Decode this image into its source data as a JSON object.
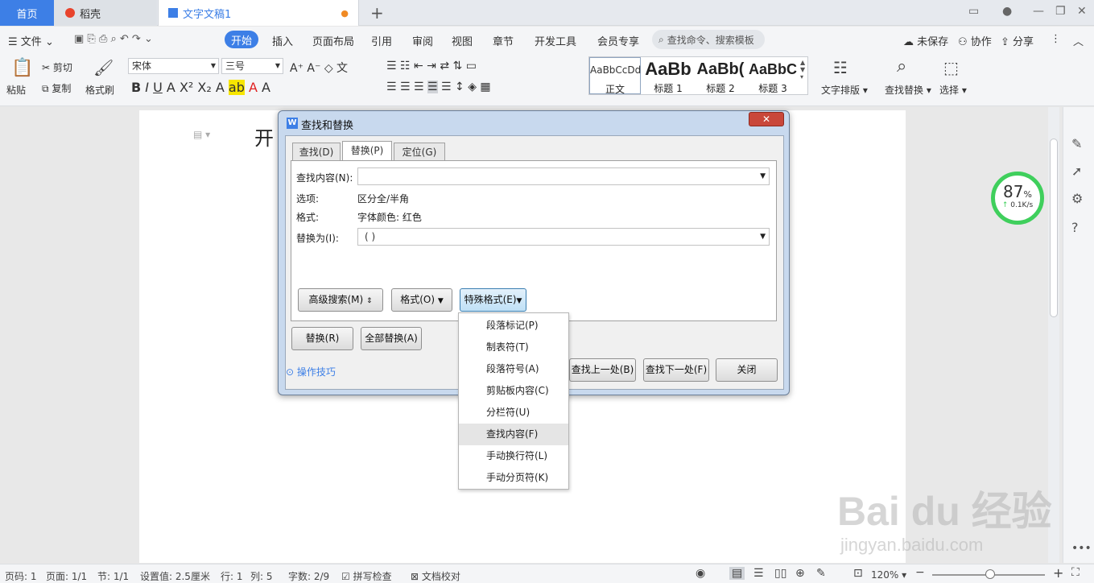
{
  "tabs": {
    "home": "首页",
    "daoke": "稻壳",
    "doc": "文字文稿1"
  },
  "menu": {
    "file": "文件",
    "items": [
      "开始",
      "插入",
      "页面布局",
      "引用",
      "审阅",
      "视图",
      "章节",
      "开发工具",
      "会员专享"
    ],
    "search_placeholder": "查找命令、搜索模板",
    "unsaved": "未保存",
    "collab": "协作",
    "share": "分享"
  },
  "ribbon": {
    "paste": "粘贴",
    "cut": "剪切",
    "copy": "复制",
    "format_painter": "格式刷",
    "font_name": "宋体",
    "font_size": "三号",
    "styles": [
      {
        "preview": "AaBbCcDd",
        "name": "正文"
      },
      {
        "preview": "AaBb",
        "name": "标题 1"
      },
      {
        "preview": "AaBb(",
        "name": "标题 2"
      },
      {
        "preview": "AaBbC",
        "name": "标题 3"
      }
    ],
    "text_layout": "文字排版",
    "find_replace": "查找替换",
    "select": "选择"
  },
  "document": {
    "text": "开"
  },
  "speed_widget": {
    "percent": "87",
    "percent_unit": "%",
    "rate": "0.1K/s"
  },
  "dialog": {
    "title": "查找和替换",
    "close": "✕",
    "tabs": [
      "查找(D)",
      "替换(P)",
      "定位(G)"
    ],
    "find_label": "查找内容(N):",
    "find_value": "",
    "options_label": "选项:",
    "options_value": "区分全/半角",
    "format_label": "格式:",
    "format_value": "字体颜色: 红色",
    "replace_label": "替换为(I):",
    "replace_value": "( )",
    "btn_advanced": "高级搜索(M)",
    "btn_format": "格式(O)",
    "btn_special": "特殊格式(E)",
    "btn_replace": "替换(R)",
    "btn_replace_all": "全部替换(A)",
    "btn_find_prev": "查找上一处(B)",
    "btn_find_next": "查找下一处(F)",
    "btn_close": "关闭",
    "tips": "操作技巧"
  },
  "special_menu": [
    "段落标记(P)",
    "制表符(T)",
    "段落符号(A)",
    "剪贴板内容(C)",
    "分栏符(U)",
    "查找内容(F)",
    "手动换行符(L)",
    "手动分页符(K)"
  ],
  "status": {
    "page_code": "页码: 1",
    "page": "页面: 1/1",
    "section": "节: 1/1",
    "setting": "设置值: 2.5厘米",
    "row": "行: 1",
    "col": "列: 5",
    "words": "字数: 2/9",
    "spell": "拼写检查",
    "proof": "文档校对",
    "zoom": "120%"
  },
  "watermark": {
    "logo": "Bai du 经验",
    "url": "jingyan.baidu.com"
  }
}
